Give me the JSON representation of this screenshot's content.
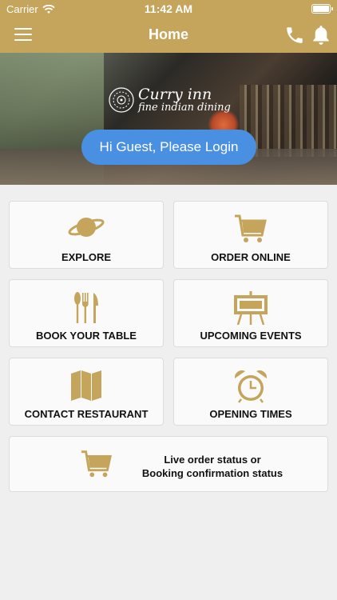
{
  "status_bar": {
    "carrier": "Carrier",
    "time": "11:42 AM"
  },
  "header": {
    "title": "Home"
  },
  "hero": {
    "logo_name": "Curry inn",
    "logo_tagline": "fine indian dining",
    "login_label": "Hi Guest, Please Login"
  },
  "tiles": {
    "explore": "EXPLORE",
    "order_online": "ORDER ONLINE",
    "book_table": "BOOK YOUR TABLE",
    "upcoming_events": "UPCOMING EVENTS",
    "contact_restaurant": "CONTACT RESTAURANT",
    "opening_times": "OPENING TIMES",
    "status_line1": "Live order status or",
    "status_line2": "Booking confirmation status"
  },
  "colors": {
    "brand": "#c4a55b",
    "accent_button": "#4a90e2",
    "background": "#efefef",
    "card": "#fafafa"
  },
  "icons": [
    "menu-icon",
    "phone-icon",
    "bell-icon",
    "planet-icon",
    "cart-icon",
    "cutlery-icon",
    "easel-icon",
    "map-icon",
    "alarm-clock-icon",
    "wifi-icon",
    "battery-icon"
  ]
}
